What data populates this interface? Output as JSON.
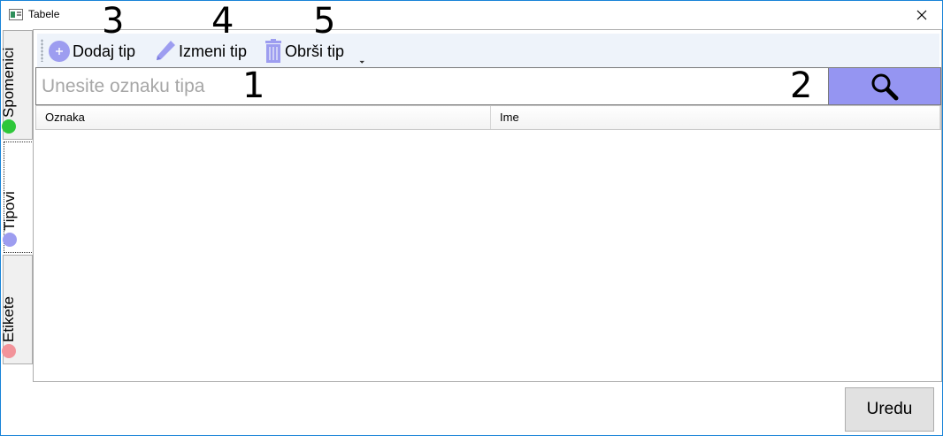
{
  "window": {
    "title": "Tabele"
  },
  "tabs": [
    {
      "label": "Spomenici",
      "dot_color": "#2ec73a"
    },
    {
      "label": "Tipovi",
      "dot_color": "#9d9df0",
      "selected": true
    },
    {
      "label": "Etikete",
      "dot_color": "#f2939a"
    }
  ],
  "toolbar": {
    "add_label": "Dodaj tip",
    "edit_label": "Izmeni tip",
    "delete_label": "Obrši tip",
    "overflow_glyph": "⏷"
  },
  "search": {
    "placeholder": "Unesite oznaku tipa",
    "value": ""
  },
  "table": {
    "columns": [
      "Oznaka",
      "Ime"
    ],
    "rows": []
  },
  "annotations": [
    "1",
    "2",
    "3",
    "4",
    "5"
  ],
  "footer": {
    "ok_label": "Uredu"
  },
  "colors": {
    "accent": "#9595f2",
    "toolbar_bg": "#eef3fa"
  }
}
